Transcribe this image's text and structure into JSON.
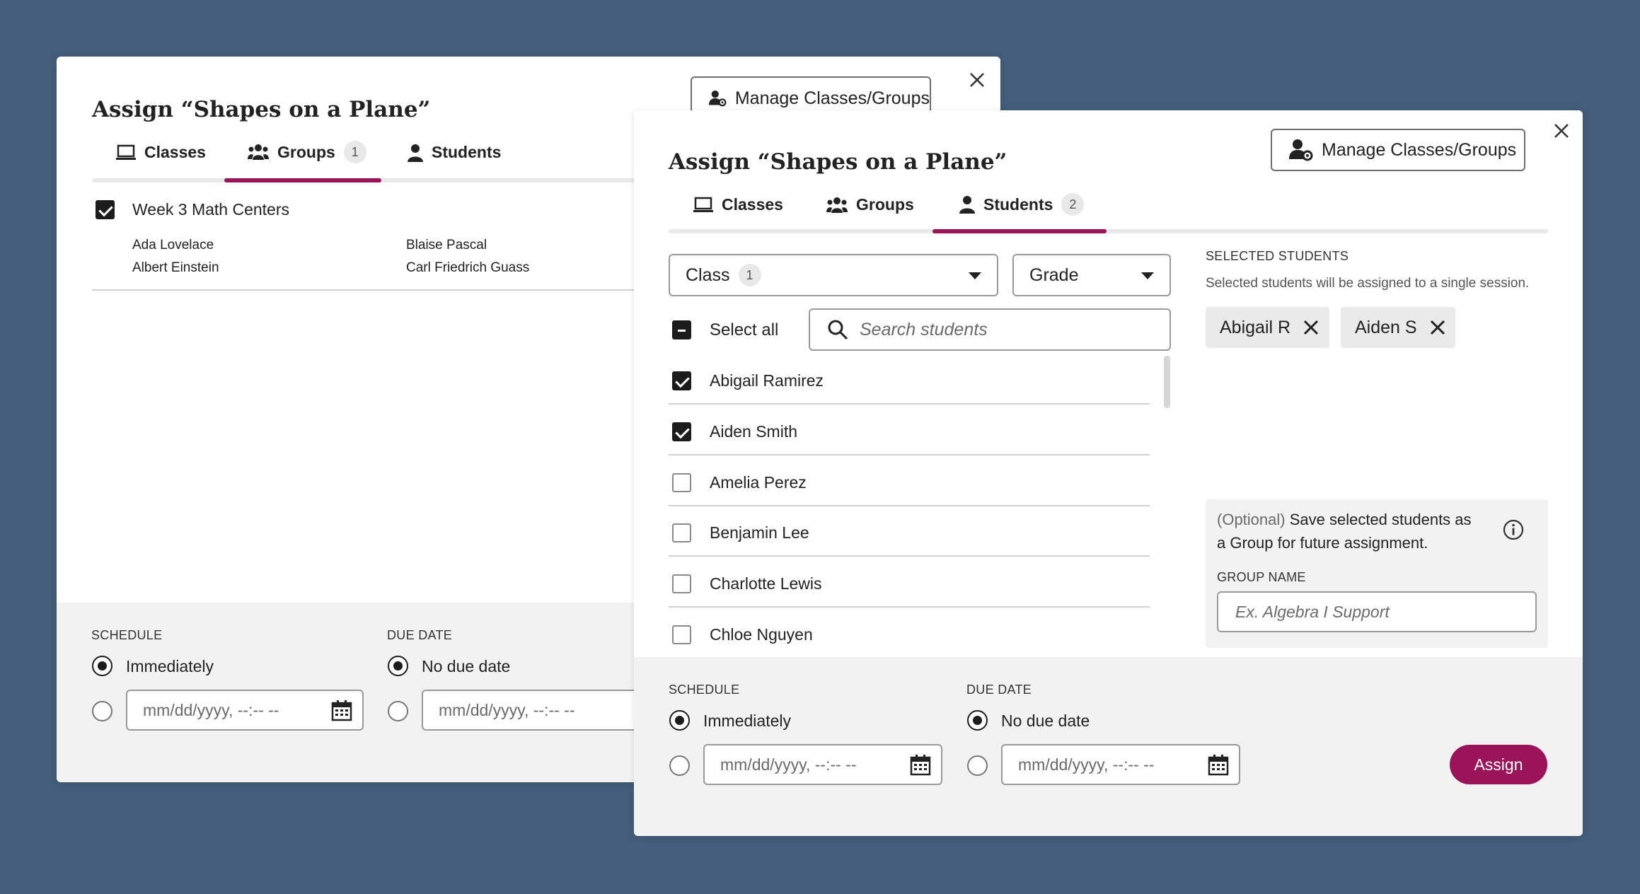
{
  "back_dialog": {
    "title": "Assign “Shapes on a Plane”",
    "manage_label": "Manage Classes/Groups",
    "tabs": [
      {
        "label": "Classes",
        "icon": "laptop-icon"
      },
      {
        "label": "Groups",
        "icon": "group-icon",
        "badge": "1",
        "active": true
      },
      {
        "label": "Students",
        "icon": "person-icon"
      }
    ],
    "group": {
      "name": "Week 3 Math Centers",
      "checked": true,
      "members": [
        "Ada Lovelace",
        "Blaise Pascal",
        "Albert Einstein",
        "Carl Friedrich Guass"
      ]
    },
    "schedule": {
      "label": "SCHEDULE",
      "immediately": "Immediately",
      "placeholder": "mm/dd/yyyy, --:-- --"
    },
    "due": {
      "label": "DUE DATE",
      "none": "No due date",
      "placeholder": "mm/dd/yyyy, --:-- --"
    }
  },
  "front_dialog": {
    "title": "Assign “Shapes on a Plane”",
    "manage_label": "Manage Classes/Groups",
    "tabs": [
      {
        "label": "Classes",
        "icon": "laptop-icon"
      },
      {
        "label": "Groups",
        "icon": "group-icon"
      },
      {
        "label": "Students",
        "icon": "person-icon",
        "badge": "2",
        "active": true
      }
    ],
    "filters": {
      "class_label": "Class",
      "class_badge": "1",
      "grade_label": "Grade"
    },
    "select_all_label": "Select all",
    "search_placeholder": "Search students",
    "students": [
      {
        "name": "Abigail Ramirez",
        "checked": true
      },
      {
        "name": "Aiden Smith",
        "checked": true
      },
      {
        "name": "Amelia Perez",
        "checked": false
      },
      {
        "name": "Benjamin Lee",
        "checked": false
      },
      {
        "name": "Charlotte Lewis",
        "checked": false
      },
      {
        "name": "Chloe Nguyen",
        "checked": false
      }
    ],
    "selected": {
      "heading": "SELECTED STUDENTS",
      "note": "Selected students will be assigned to a single session.",
      "chips": [
        "Abigail R",
        "Aiden S"
      ]
    },
    "save_group": {
      "optional": "(Optional)",
      "text_line1": " Save selected students as",
      "text_line2": "a Group for future assignment.",
      "name_label": "GROUP NAME",
      "name_placeholder": "Ex. Algebra I Support"
    },
    "schedule": {
      "label": "SCHEDULE",
      "immediately": "Immediately",
      "placeholder": "mm/dd/yyyy, --:-- --"
    },
    "due": {
      "label": "DUE DATE",
      "none": "No due date",
      "placeholder": "mm/dd/yyyy, --:-- --"
    },
    "assign_label": "Assign"
  },
  "colors": {
    "background": "#445d7a",
    "accent": "#9b1459",
    "footer": "#f2f2f2"
  }
}
